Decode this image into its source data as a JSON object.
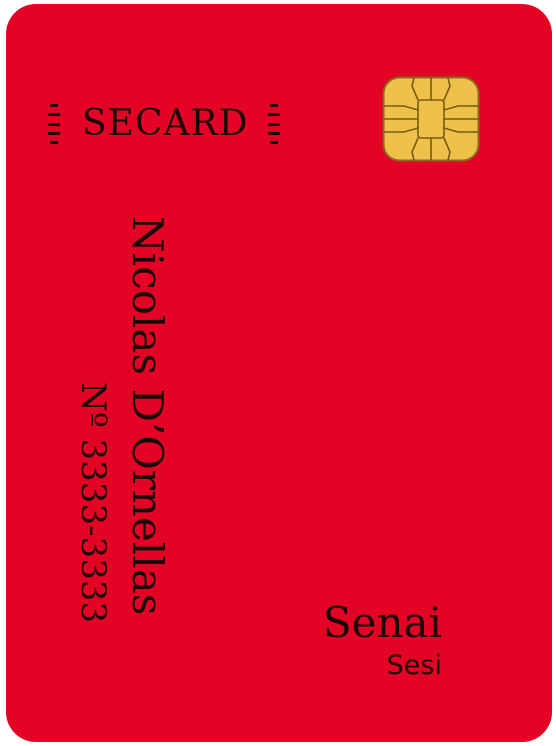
{
  "card": {
    "brand": "SECARD",
    "holder_name": "Nicolas D’Ornellas",
    "number": "Nº 3333-3333",
    "issuer": "Senai",
    "sub_issuer": "Sesi"
  },
  "colors": {
    "card_background": "#e30425",
    "text": "#1a0508",
    "chip_gold": "#f0c14a",
    "chip_lines": "#7a5a12"
  },
  "icons": {
    "chip": "smart-card-chip-icon",
    "ticks": "stripe-ticks-icon"
  }
}
